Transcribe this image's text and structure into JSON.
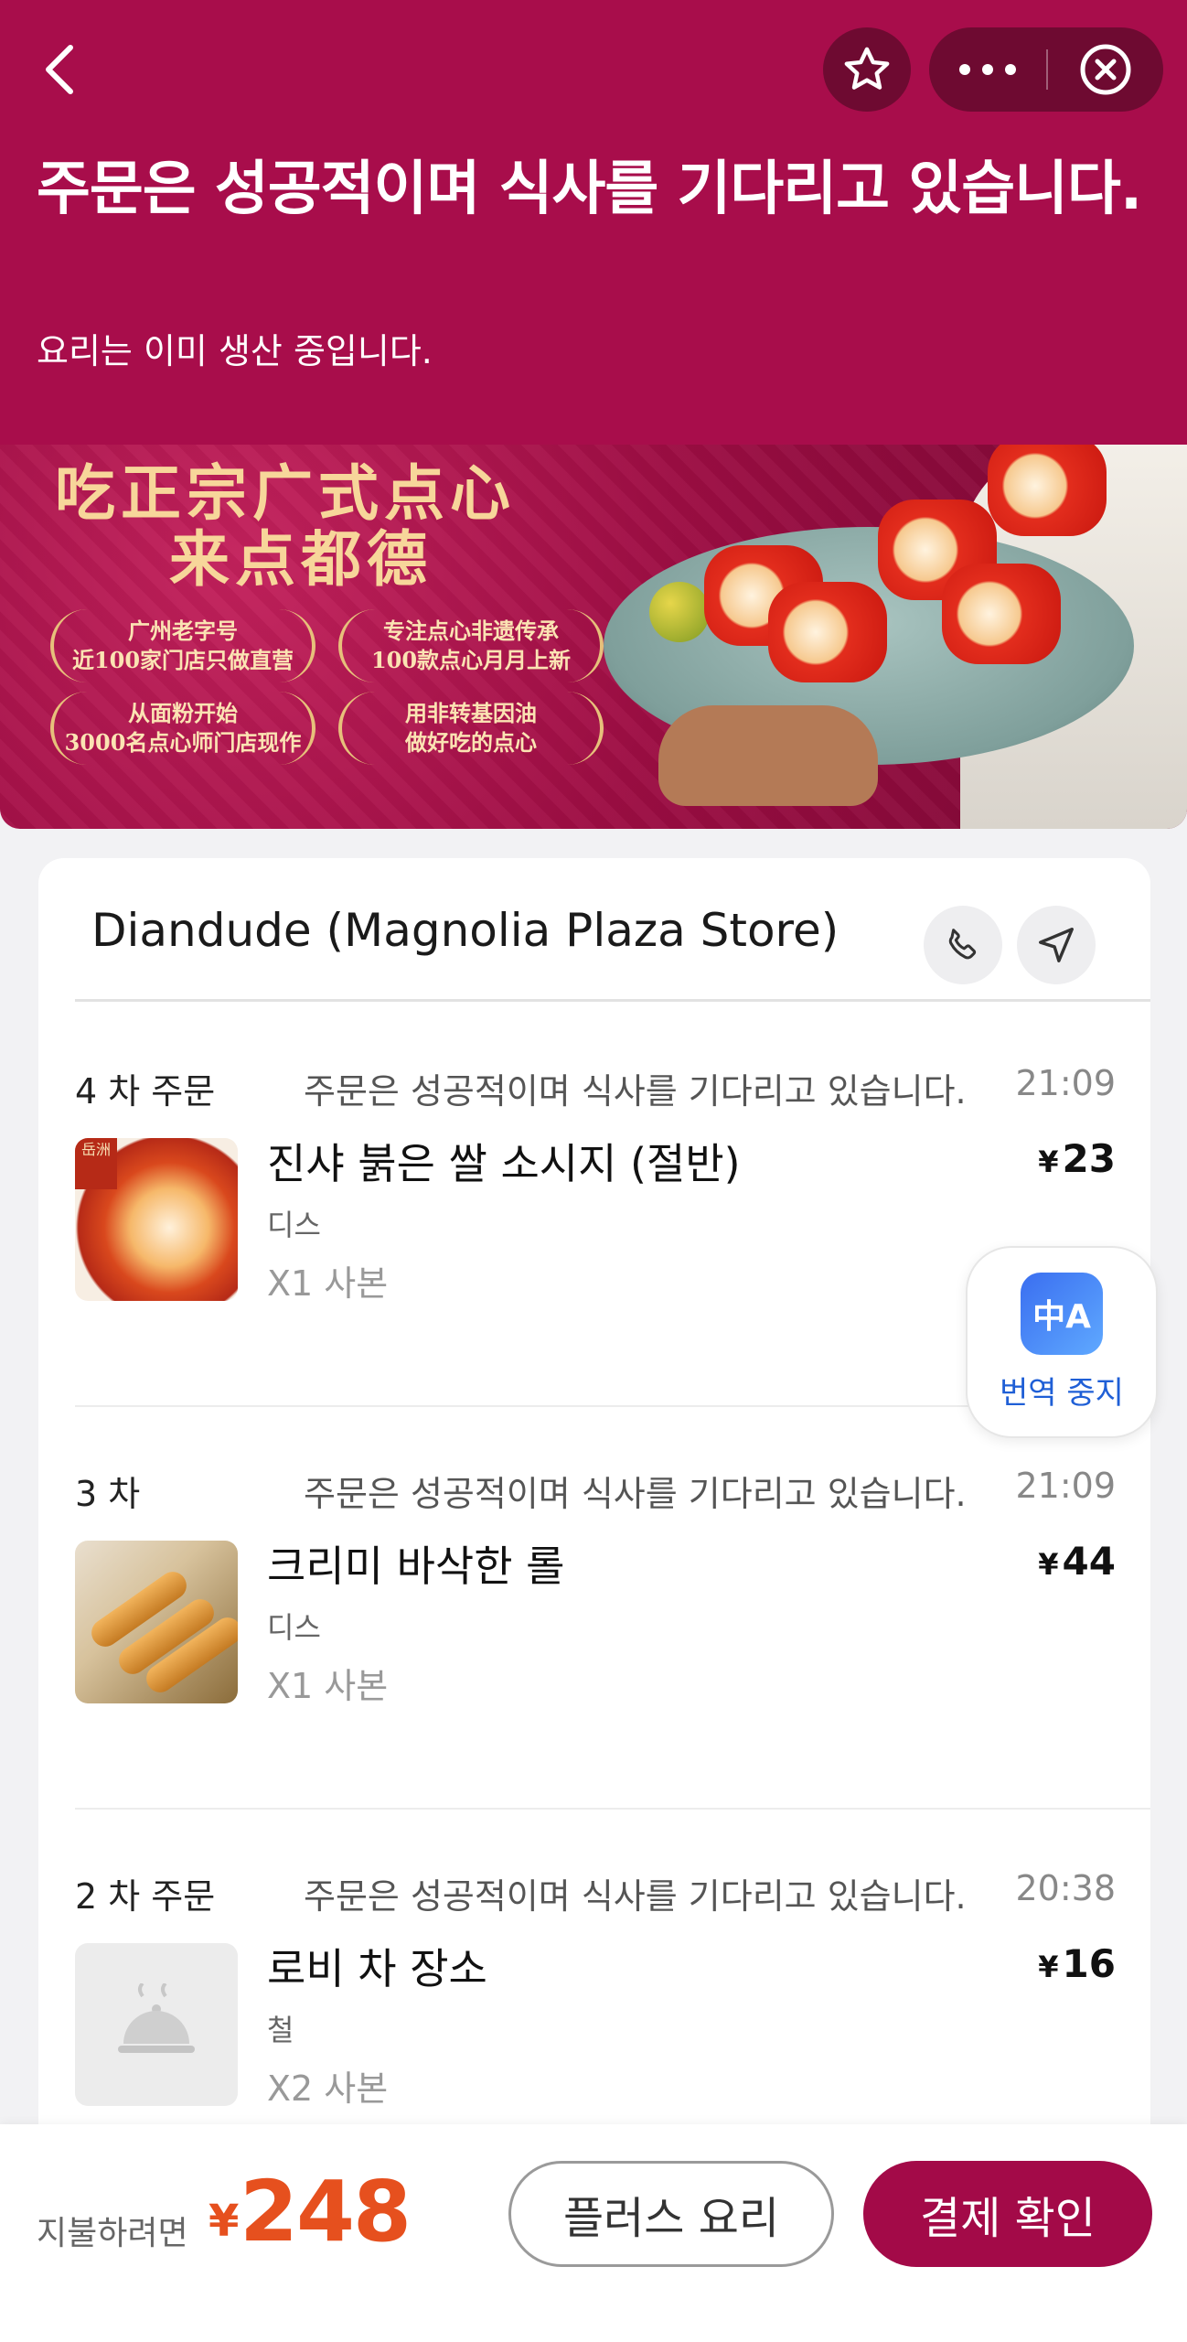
{
  "header": {
    "title": "주문은 성공적이며 식사를 기다리고 있습니다.",
    "subtitle": "요리는 이미 생산 중입니다.",
    "back_icon": "chevron-left-icon",
    "favorite_icon": "star-icon",
    "more_icon": "more-dots-icon",
    "close_icon": "close-circle-icon",
    "bg_color": "#a80d4b"
  },
  "banner": {
    "line1": "吃正宗广式点心",
    "line2": "来点都德",
    "badges": [
      {
        "top": "广州老字号",
        "bottom": "近100家门店只做直营"
      },
      {
        "top": "专注点心非遗传承",
        "bottom": "100款点心月月上新"
      },
      {
        "top": "从面粉开始",
        "bottom": "3000名点心师门店现作"
      },
      {
        "top": "用非转基因油",
        "bottom": "做好吃的点心"
      }
    ]
  },
  "store": {
    "name": "Diandude (Magnolia Plaza Store)",
    "phone_icon": "phone-icon",
    "navigate_icon": "navigation-arrow-icon"
  },
  "orders": [
    {
      "round": "4 차 주문",
      "status": "주문은 성공적이며 식사를 기다리고 있습니다.",
      "time": "21:09",
      "item_name": "진샤 붉은 쌀 소시지 (절반)",
      "currency": "¥",
      "price": "23",
      "dish": "디스",
      "qty": "X1 사본",
      "image_label": "岳洲"
    },
    {
      "round": "3 차",
      "status": "주문은 성공적이며 식사를 기다리고 있습니다.",
      "time": "21:09",
      "item_name": "크리미 바삭한 롤",
      "currency": "¥",
      "price": "44",
      "dish": "디스",
      "qty": "X1 사본"
    },
    {
      "round": "2 차 주문",
      "status": "주문은 성공적이며 식사를 기다리고 있습니다.",
      "time": "20:38",
      "item_name": "로비 차 장소",
      "currency": "¥",
      "price": "16",
      "dish": "철",
      "qty": "X2 사본"
    }
  ],
  "translate": {
    "label": "번역 중지",
    "icon_text": "中A"
  },
  "footer": {
    "pay_label": "지불하려면",
    "currency": "¥",
    "amount": "248",
    "plus_button": "플러스 요리",
    "confirm_button": "결제 확인",
    "accent_color": "#e6501e",
    "brand_color": "#a30a48"
  }
}
